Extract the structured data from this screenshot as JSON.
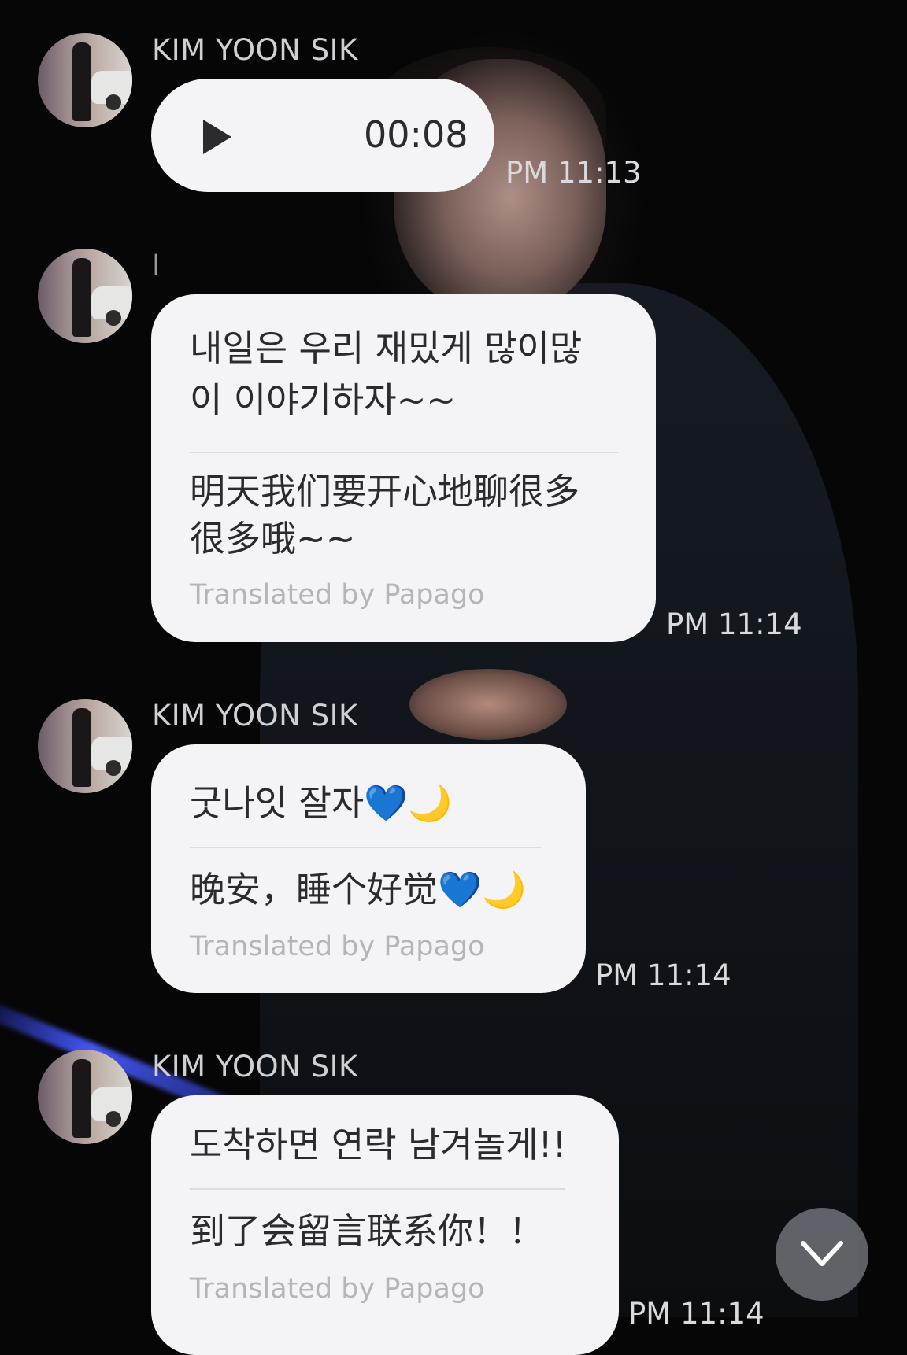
{
  "sender_name": "KIM YOON SIK",
  "papago_note": "Translated by Papago",
  "messages": [
    {
      "type": "voice",
      "duration": "00:08",
      "time": "PM 11:13"
    },
    {
      "type": "text",
      "sender_partial": "K",
      "original_lines": [
        "내일은 우리 재밌게 많이많",
        "이 이야기하자~~"
      ],
      "translated_lines": [
        "明天我们要开心地聊很多",
        "很多哦~~"
      ],
      "time": "PM 11:14"
    },
    {
      "type": "text",
      "original_lines": [
        "굿나잇 잘자💙🌙"
      ],
      "translated_lines": [
        "晚安，睡个好觉💙🌙"
      ],
      "time": "PM 11:14"
    },
    {
      "type": "text",
      "original_lines": [
        "도착하면 연락 남겨놀게!!"
      ],
      "translated_lines": [
        "到了会留言联系你！！"
      ],
      "time": "PM 11:14"
    }
  ],
  "icons": {
    "play": "play-icon",
    "scroll_down": "chevron-down-icon"
  }
}
